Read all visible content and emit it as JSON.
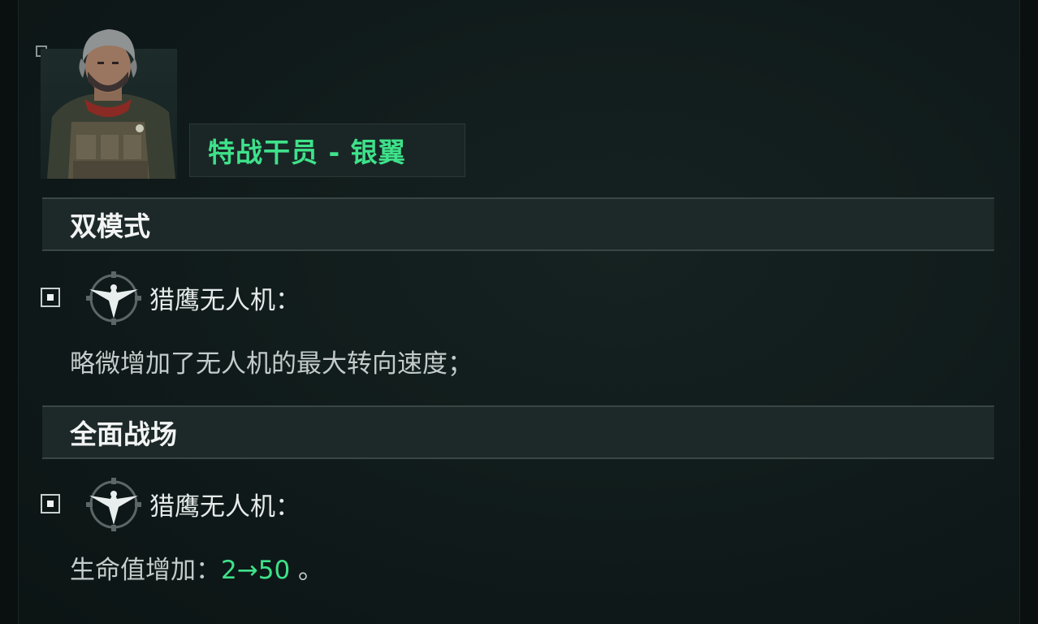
{
  "operator": {
    "title": "特战干员 - 银翼"
  },
  "sections": [
    {
      "header": "双模式",
      "item": {
        "icon": "eagle-drone-icon",
        "label": "猎鹰无人机：",
        "description": "略微增加了无人机的最大转向速度；"
      }
    },
    {
      "header": "全面战场",
      "item": {
        "icon": "eagle-drone-icon",
        "label": "猎鹰无人机：",
        "description_prefix": "生命值增加：",
        "description_from": "2",
        "description_arrow": "→",
        "description_to": "50",
        "description_suffix": "。"
      }
    }
  ],
  "colors": {
    "accent_green": "#3ee28a",
    "panel_bg": "#101a1a",
    "header_bg": "#1d2828"
  }
}
